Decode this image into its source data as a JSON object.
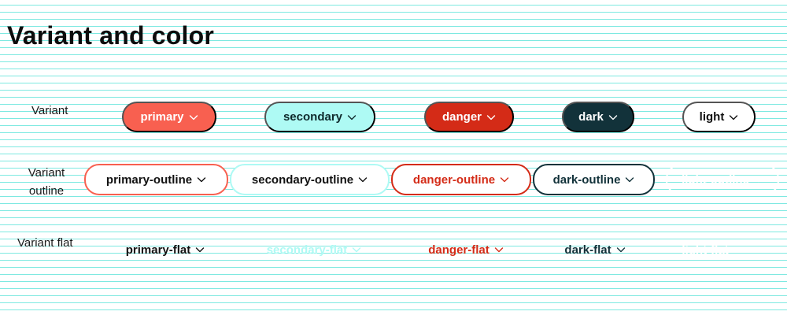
{
  "page": {
    "title": "Variant and color"
  },
  "row_labels": {
    "variant": "Variant",
    "variant_outline": "Variant outline",
    "variant_flat": "Variant flat"
  },
  "icon": "chevron-down-icon",
  "colors": {
    "primary": "#f86050",
    "secondary": "#aefaf4",
    "danger": "#d42b17",
    "dark": "#12323a",
    "light": "#ffffff",
    "guideline": "#7ee9e1"
  },
  "buttons": {
    "variant": {
      "primary": "primary",
      "secondary": "secondary",
      "danger": "danger",
      "dark": "dark",
      "light": "light"
    },
    "outline": {
      "primary": "primary-outline",
      "secondary": "secondary-outline",
      "danger": "danger-outline",
      "dark": "dark-outline",
      "light": "light-outline"
    },
    "flat": {
      "primary": "primary-flat",
      "secondary": "secondary-flat",
      "danger": "danger-flat",
      "dark": "dark-flat",
      "light": "light-flat"
    }
  }
}
